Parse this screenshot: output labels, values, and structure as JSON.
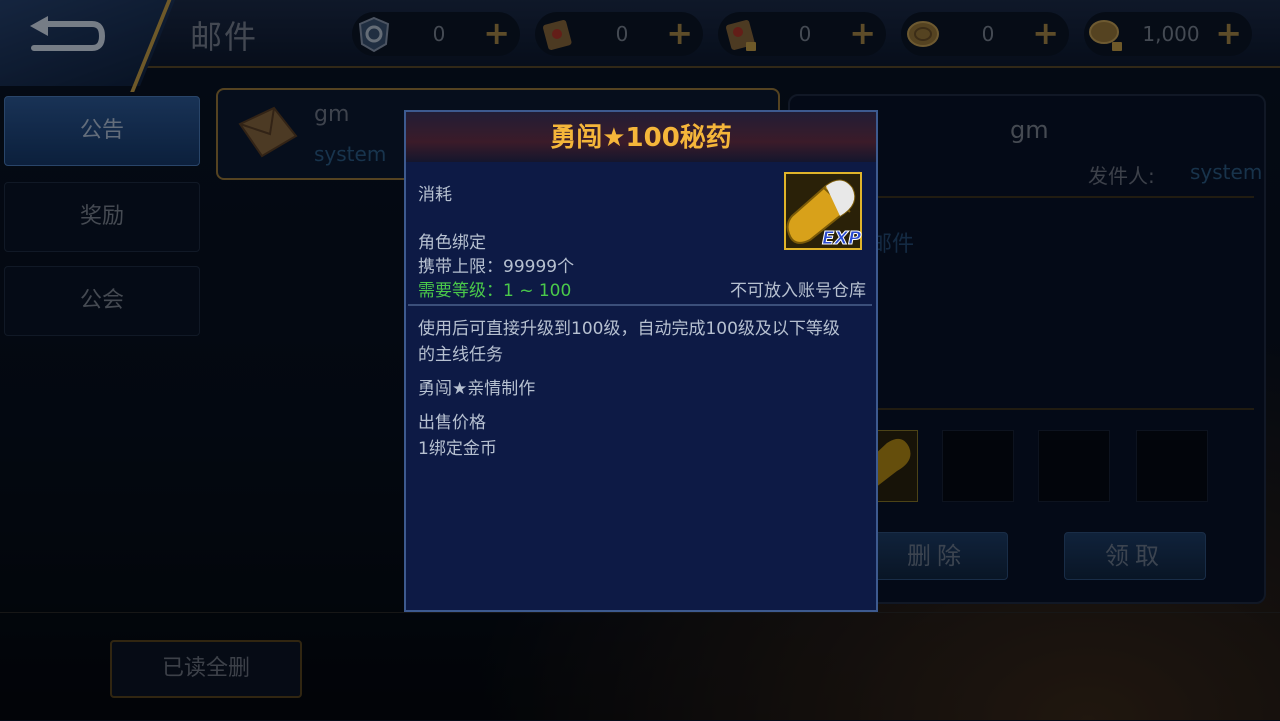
{
  "header": {
    "title": "邮件",
    "back_icon": "back-arrow-icon",
    "resources": [
      {
        "icon": "badge-coin-icon",
        "value": "0"
      },
      {
        "icon": "scroll-icon",
        "value": "0"
      },
      {
        "icon": "locked-scroll-icon",
        "value": "0"
      },
      {
        "icon": "gold-coin-icon",
        "value": "0"
      },
      {
        "icon": "locked-gold-coin-icon",
        "value": "1,000"
      }
    ],
    "plus": "+"
  },
  "tabs": [
    {
      "label": "公告",
      "active": true
    },
    {
      "label": "奖励",
      "active": false
    },
    {
      "label": "公会",
      "active": false
    }
  ],
  "mail_list": [
    {
      "sender": "gm",
      "from": "system",
      "icon": "envelope-icon"
    }
  ],
  "detail": {
    "title": "gm",
    "sender_label": "发件人:",
    "sender": "system",
    "body_fragment": "邮件",
    "delete_label": "删除",
    "claim_label": "领取"
  },
  "bottom": {
    "clear_read_label": "已读全删"
  },
  "tooltip": {
    "title": "勇闯★100秘药",
    "type": "消耗",
    "binding": "角色绑定",
    "carry_limit": "携带上限：99999个",
    "level_req": "需要等级：1 ~ 100",
    "storage_note": "不可放入账号仓库",
    "desc_line1": "使用后可直接升级到100级，自动完成100级及以下等级",
    "desc_line2": "的主线任务",
    "maker": "勇闯★亲情制作",
    "price_label": "出售价格",
    "price_value": "1绑定金币",
    "icon": "exp-capsule-icon",
    "icon_text": "EXP"
  },
  "colors": {
    "accent_gold": "#f5b63a",
    "green_text": "#4ac94a",
    "link_blue": "#2c5f8c"
  }
}
